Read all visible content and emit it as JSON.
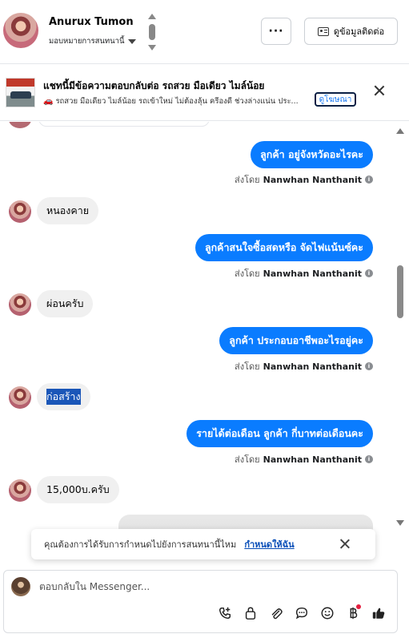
{
  "header": {
    "contact_name": "Anurux Tumon",
    "assign_label": "มอบหมายการสนทนานี้",
    "more_label": "···",
    "contact_info_label": "ดูข้อมูลติดต่อ"
  },
  "ad": {
    "title": "แชทนี้มีข้อความตอบกลับต่อ รถสวย มือเดียว ไมล์น้อย",
    "subtitle": "รถสวย มือเดียว ไมล์น้อย รถเข้าใหม่ ไม่ต้องลุ้น ครีองดี ช่วงล่างแน่น ประ...",
    "link_label": "ดูโฆษณา"
  },
  "messages": [
    {
      "dir": "out",
      "text": "ลูกค้า  อยู่จังหวัดอะไรคะ",
      "sent_by_prefix": "ส่งโดย",
      "sender": "Nanwhan Nanthanit"
    },
    {
      "dir": "in",
      "text": "หนองคาย"
    },
    {
      "dir": "out",
      "text": "ลูกค้าสนใจซื้อสดหรือ จัดไฟแน้นซ์คะ",
      "sent_by_prefix": "ส่งโดย",
      "sender": "Nanwhan Nanthanit"
    },
    {
      "dir": "in",
      "text": "ผ่อนครับ"
    },
    {
      "dir": "out",
      "text": "ลูกค้า ประกอบอาชีพอะไรอยู่คะ",
      "sent_by_prefix": "ส่งโดย",
      "sender": "Nanwhan Nanthanit"
    },
    {
      "dir": "in",
      "text": "ก่อสร้าง",
      "selected": true
    },
    {
      "dir": "out",
      "text": "รายได้ต่อเดือน  ลูกค้า กี่บาทต่อเดือนคะ",
      "sent_by_prefix": "ส่งโดย",
      "sender": "Nanwhan Nanthanit"
    },
    {
      "dir": "in",
      "text": "15,000บ.ครับ"
    }
  ],
  "toast": {
    "text": "คุณต้องการได้รับการกำหนดไปยังการสนทนานี้ไหม",
    "link": "กำหนดให้ฉัน"
  },
  "composer": {
    "placeholder": "ตอบกลับใน Messenger..."
  },
  "toolbar_icons": [
    "call-add-icon",
    "lock-icon",
    "attachment-icon",
    "chat-bubble-icon",
    "emoji-icon",
    "baht-icon",
    "thumbs-up-icon"
  ],
  "colors": {
    "outgoing_bubble": "#0a7cff",
    "incoming_bubble": "#f0f0f0",
    "link": "#0a4fb8",
    "notification_dot": "#e41e3f"
  }
}
